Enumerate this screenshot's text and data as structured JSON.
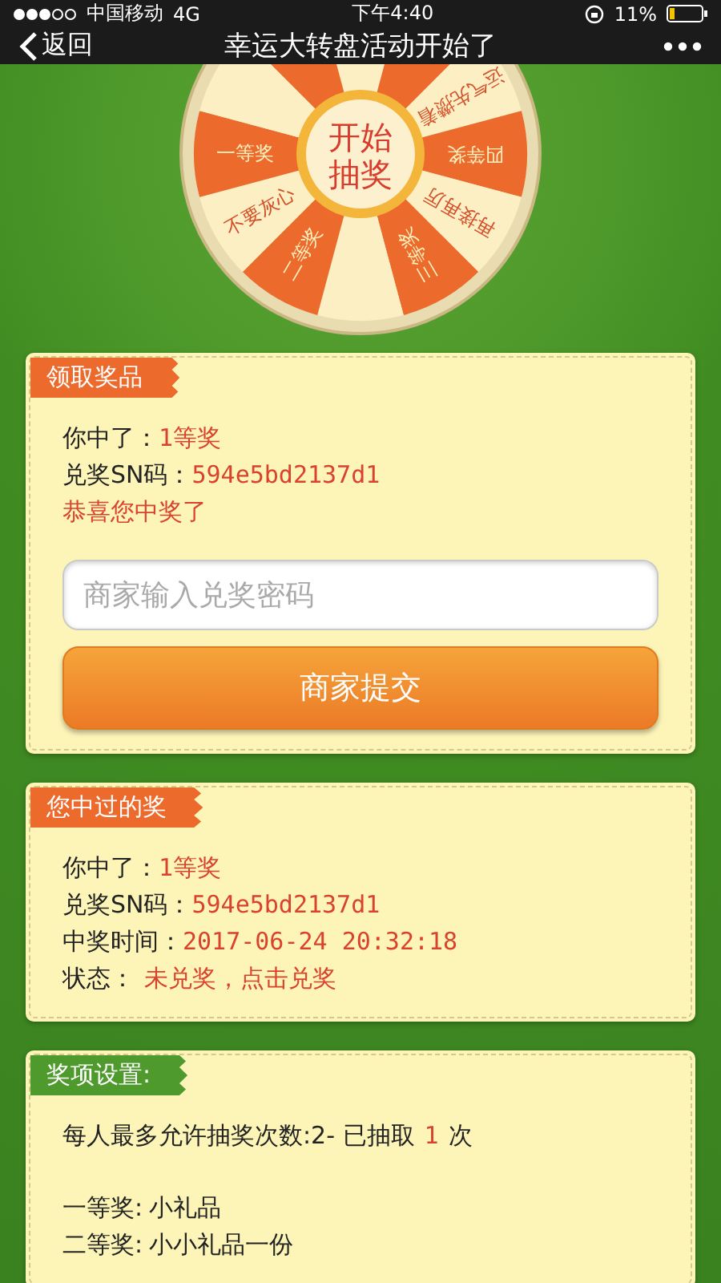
{
  "status_bar": {
    "carrier": "中国移动",
    "network": "4G",
    "time": "下午4:40",
    "battery": "11%"
  },
  "nav": {
    "back": "返回",
    "title": "幸运大转盘活动开始了"
  },
  "wheel": {
    "button": "开始抽奖",
    "segments": [
      {
        "kind": "blank"
      },
      {
        "kind": "prize"
      },
      {
        "kind": "blank",
        "label": "运气先攒着"
      },
      {
        "kind": "prize",
        "label": "四等奖"
      },
      {
        "kind": "blank",
        "label": "再接再厉"
      },
      {
        "kind": "prize",
        "label": "三等奖"
      },
      {
        "kind": "blank"
      },
      {
        "kind": "prize",
        "label": "二等奖"
      },
      {
        "kind": "blank",
        "label": "不要灰心"
      },
      {
        "kind": "prize",
        "label": "一等奖"
      },
      {
        "kind": "blank"
      },
      {
        "kind": "prize"
      }
    ]
  },
  "claim": {
    "title": "领取奖品",
    "rows": [
      {
        "label": "你中了：",
        "value": "1等奖"
      },
      {
        "label": "兑奖SN码：",
        "value": "594e5bd2137d1"
      }
    ],
    "message": "恭喜您中奖了",
    "password": {
      "placeholder": "商家输入兑奖密码"
    },
    "submit": "商家提交"
  },
  "history": {
    "title": "您中过的奖",
    "rows": [
      {
        "label": "你中了：",
        "value": "1等奖",
        "kind": "text"
      },
      {
        "label": "兑奖SN码：",
        "value": "594e5bd2137d1",
        "kind": "text"
      },
      {
        "label": "中奖时间：",
        "value": "2017-06-24 20:32:18",
        "kind": "text"
      },
      {
        "label": "状态：",
        "value": "未兑奖，点击兑奖",
        "kind": "link"
      }
    ]
  },
  "settings": {
    "title": "奖项设置:",
    "limit": {
      "prefix": "每人最多允许抽奖次数:2- 已抽取",
      "count": "1",
      "suffix": "次"
    },
    "prizes": [
      {
        "label": "一等奖:",
        "value": "小礼品"
      },
      {
        "label": "二等奖:",
        "value": "小小礼品一份"
      }
    ]
  }
}
